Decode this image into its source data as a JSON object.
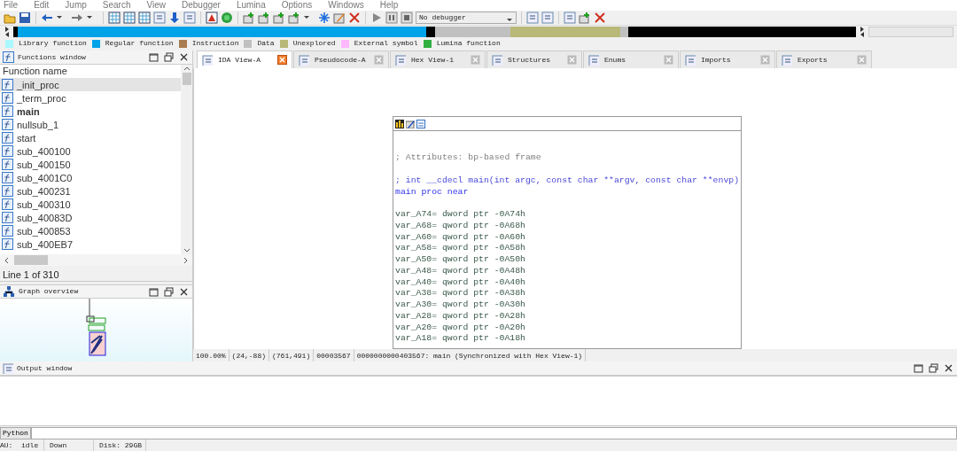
{
  "menu": [
    "File",
    "Edit",
    "Jump",
    "Search",
    "View",
    "Debugger",
    "Lumina",
    "Options",
    "Windows",
    "Help"
  ],
  "toolbar": {
    "debugger_select": "No debugger"
  },
  "legend": [
    {
      "label": "Library function",
      "color": "#aaf8ff"
    },
    {
      "label": "Regular function",
      "color": "#00a2e8"
    },
    {
      "label": "Instruction",
      "color": "#a87c50"
    },
    {
      "label": "Data",
      "color": "#c0c0c0"
    },
    {
      "label": "Unexplored",
      "color": "#b8b878"
    },
    {
      "label": "External symbol",
      "color": "#ffb8ff"
    },
    {
      "label": "Lumina function",
      "color": "#30b040"
    }
  ],
  "functions_window": {
    "title": "Functions window",
    "column": "Function name",
    "status": "Line 1 of 310",
    "items": [
      {
        "name": "_init_proc",
        "selected": true,
        "bold": false
      },
      {
        "name": "_term_proc",
        "selected": false,
        "bold": false
      },
      {
        "name": "main",
        "selected": false,
        "bold": true
      },
      {
        "name": "nullsub_1",
        "selected": false,
        "bold": false
      },
      {
        "name": "start",
        "selected": false,
        "bold": false
      },
      {
        "name": "sub_400100",
        "selected": false,
        "bold": false
      },
      {
        "name": "sub_400150",
        "selected": false,
        "bold": false
      },
      {
        "name": "sub_4001C0",
        "selected": false,
        "bold": false
      },
      {
        "name": "sub_400231",
        "selected": false,
        "bold": false
      },
      {
        "name": "sub_400310",
        "selected": false,
        "bold": false
      },
      {
        "name": "sub_40083D",
        "selected": false,
        "bold": false
      },
      {
        "name": "sub_400853",
        "selected": false,
        "bold": false
      },
      {
        "name": "sub_400EB7",
        "selected": false,
        "bold": false
      }
    ]
  },
  "graph_overview": {
    "title": "Graph overview"
  },
  "tabs": [
    {
      "label": "IDA View-A",
      "selected": true
    },
    {
      "label": "Pseudocode-A",
      "selected": false
    },
    {
      "label": "Hex View-1",
      "selected": false
    },
    {
      "label": "Structures",
      "selected": false
    },
    {
      "label": "Enums",
      "selected": false
    },
    {
      "label": "Imports",
      "selected": false
    },
    {
      "label": "Exports",
      "selected": false
    }
  ],
  "disassembly": {
    "blocks": [
      [
        {
          "kind": "comment",
          "text": "; Attributes: bp-based frame"
        }
      ],
      [
        {
          "kind": "prototype",
          "text": "; int __cdecl main(int argc, const char **argv, const char **envp)"
        },
        {
          "kind": "label",
          "text": "main proc near"
        }
      ],
      [
        {
          "kind": "variable",
          "text": "var_A74= dword ptr -0A74h"
        },
        {
          "kind": "variable",
          "text": "var_A68= qword ptr -0A68h"
        },
        {
          "kind": "variable",
          "text": "var_A60= qword ptr -0A60h"
        },
        {
          "kind": "variable",
          "text": "var_A58= qword ptr -0A58h"
        },
        {
          "kind": "variable",
          "text": "var_A50= qword ptr -0A50h"
        },
        {
          "kind": "variable",
          "text": "var_A48= qword ptr -0A48h"
        },
        {
          "kind": "variable",
          "text": "var_A40= qword ptr -0A40h"
        },
        {
          "kind": "variable",
          "text": "var_A38= qword ptr -0A38h"
        },
        {
          "kind": "variable",
          "text": "var_A30= qword ptr -0A30h"
        },
        {
          "kind": "variable",
          "text": "var_A28= qword ptr -0A28h"
        },
        {
          "kind": "variable",
          "text": "var_A20= qword ptr -0A20h"
        },
        {
          "kind": "variable",
          "text": "var_A18= qword ptr -0A18h"
        }
      ]
    ]
  },
  "view_status": [
    "100.00%",
    "(24,-88)",
    "(761,491)",
    "00003567",
    "0000000000403567: main (Synchronized with Hex View-1)"
  ],
  "output_window": {
    "title": "Output window",
    "input_label": "Python"
  },
  "status_bar": [
    "AU:  idle",
    "Down",
    "Disk: 29GB"
  ]
}
